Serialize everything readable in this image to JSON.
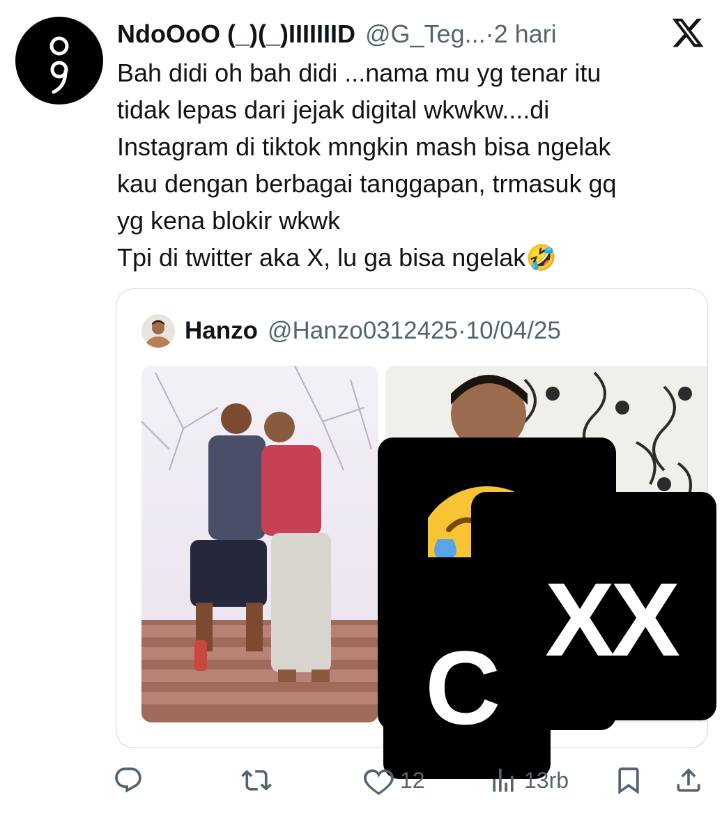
{
  "tweet": {
    "display_name": "NdoOoO (_)(_)IIIIIIID",
    "handle": "@G_Teg...",
    "separator": " · ",
    "time": "2 hari",
    "lines": [
      "Bah didi oh bah didi ...nama mu yg tenar itu",
      "tidak lepas dari jejak digital wkwkw....di",
      "Instagram di tiktok mngkin mash bisa ngelak",
      "kau dengan berbagai tanggapan, trmasuk gq",
      "yg kena blokir wkwk",
      "Tpi di twitter aka X, lu ga bisa ngelak🤣"
    ]
  },
  "quote": {
    "display_name": "Hanzo",
    "handle": "@Hanzo0312425",
    "separator": " · ",
    "date": "10/04/25"
  },
  "overlay": {
    "text_right": "XX",
    "text_left": "C"
  },
  "actions": {
    "reply_icon": "reply-icon",
    "repost_icon": "repost-icon",
    "like_icon": "heart-icon",
    "like_count": "12",
    "views_icon": "views-icon",
    "views_count": "13rb",
    "bookmark_icon": "bookmark-icon",
    "share_icon": "share-icon"
  },
  "colors": {
    "text": "#0f1419",
    "muted": "#536471",
    "border": "#cfd9de",
    "overlay": "#000000"
  }
}
